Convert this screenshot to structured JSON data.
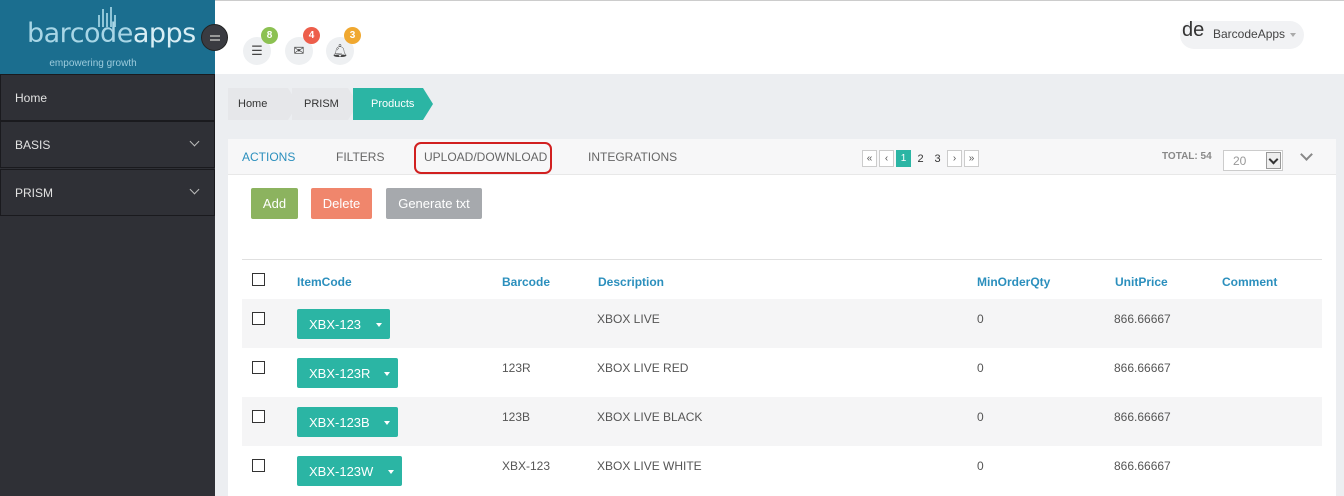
{
  "brand": {
    "name_part1": "barcode",
    "name_part2": "apps",
    "tagline": "empowering growth"
  },
  "sidebar": {
    "items": [
      {
        "label": "Home",
        "expandable": false
      },
      {
        "label": "BASIS",
        "expandable": true
      },
      {
        "label": "PRISM",
        "expandable": true
      }
    ]
  },
  "header": {
    "notifications": [
      {
        "icon": "tasks-icon",
        "count": "8",
        "color": "#8cc152"
      },
      {
        "icon": "envelope-icon",
        "count": "4",
        "color": "#ed5e4b"
      },
      {
        "icon": "bell-icon",
        "count": "3",
        "color": "#f0a830"
      }
    ],
    "user": {
      "avatar_text": "de",
      "name": "BarcodeApps"
    }
  },
  "breadcrumb": [
    "Home",
    "PRISM",
    "Products"
  ],
  "tabs": {
    "actions": "ACTIONS",
    "filters": "FILTERS",
    "upload_download": "UPLOAD/DOWNLOAD",
    "integrations": "INTEGRATIONS"
  },
  "pagination": {
    "first": "«",
    "prev": "‹",
    "pages": [
      "1",
      "2",
      "3"
    ],
    "current": "1",
    "next": "›",
    "last": "»",
    "total_label": "TOTAL: 54",
    "page_size": "20"
  },
  "buttons": {
    "add": "Add",
    "delete": "Delete",
    "generate": "Generate txt"
  },
  "colors": {
    "accent": "#2bb5a4",
    "link": "#2b8fbd",
    "sidebar": "#2f3036",
    "logo_bg": "#1b6e8f",
    "highlight": "#d12020"
  },
  "table": {
    "columns": [
      "ItemCode",
      "Barcode",
      "Description",
      "MinOrderQty",
      "UnitPrice",
      "Comment"
    ],
    "rows": [
      {
        "itemcode": "XBX-123",
        "barcode": "",
        "description": "XBOX LIVE",
        "minorderqty": "0",
        "unitprice": "866.66667",
        "comment": ""
      },
      {
        "itemcode": "XBX-123R",
        "barcode": "123R",
        "description": "XBOX LIVE RED",
        "minorderqty": "0",
        "unitprice": "866.66667",
        "comment": ""
      },
      {
        "itemcode": "XBX-123B",
        "barcode": "123B",
        "description": "XBOX LIVE BLACK",
        "minorderqty": "0",
        "unitprice": "866.66667",
        "comment": ""
      },
      {
        "itemcode": "XBX-123W",
        "barcode": "XBX-123",
        "description": "XBOX LIVE WHITE",
        "minorderqty": "0",
        "unitprice": "866.66667",
        "comment": ""
      }
    ]
  }
}
